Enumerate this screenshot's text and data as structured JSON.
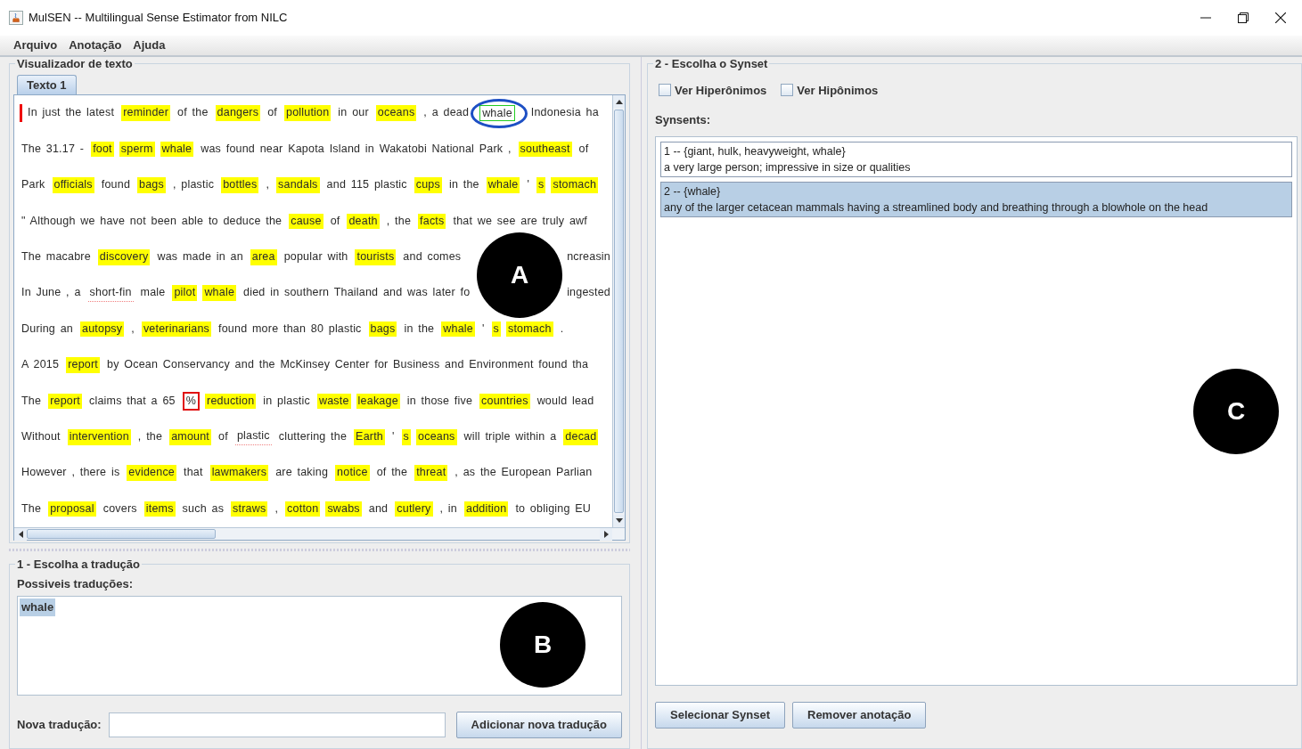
{
  "window": {
    "title": "MulSEN -- Multilingual Sense Estimator from NILC"
  },
  "menu": [
    "Arquivo",
    "Anotação",
    "Ajuda"
  ],
  "text_viewer": {
    "title": "Visualizador de texto",
    "cursor": true,
    "tabs": [
      {
        "label": "Texto 1",
        "selected": true
      }
    ],
    "callout": "A",
    "lines": [
      {
        "tokens": [
          {
            "text": "In just the latest",
            "kind": "plain"
          },
          {
            "text": "reminder",
            "kind": "highlight"
          },
          {
            "text": "of the",
            "kind": "plain"
          },
          {
            "text": "dangers",
            "kind": "highlight"
          },
          {
            "text": "of",
            "kind": "plain"
          },
          {
            "text": "pollution",
            "kind": "highlight"
          },
          {
            "text": "in our",
            "kind": "plain"
          },
          {
            "text": "oceans",
            "kind": "highlight"
          },
          {
            "text": ", a dead",
            "kind": "plain"
          },
          {
            "text": "whale",
            "kind": "selected",
            "circled": true
          },
          {
            "text": "Indonesia ha",
            "kind": "plain"
          }
        ]
      },
      {
        "tokens": [
          {
            "text": "The 31.17 -",
            "kind": "plain"
          },
          {
            "text": "foot",
            "kind": "highlight"
          },
          {
            "text": "sperm",
            "kind": "highlight"
          },
          {
            "text": "whale",
            "kind": "highlight"
          },
          {
            "text": "was found near Kapota Island in Wakatobi National Park ,",
            "kind": "plain"
          },
          {
            "text": "southeast",
            "kind": "highlight"
          },
          {
            "text": "of",
            "kind": "plain"
          }
        ]
      },
      {
        "tokens": [
          {
            "text": "Park",
            "kind": "plain"
          },
          {
            "text": "officials",
            "kind": "highlight"
          },
          {
            "text": "found",
            "kind": "plain"
          },
          {
            "text": "bags",
            "kind": "highlight"
          },
          {
            "text": ", plastic",
            "kind": "plain"
          },
          {
            "text": "bottles",
            "kind": "highlight"
          },
          {
            "text": ",",
            "kind": "plain"
          },
          {
            "text": "sandals",
            "kind": "highlight"
          },
          {
            "text": "and 115 plastic",
            "kind": "plain"
          },
          {
            "text": "cups",
            "kind": "highlight"
          },
          {
            "text": "in the",
            "kind": "plain"
          },
          {
            "text": "whale",
            "kind": "highlight"
          },
          {
            "text": "'",
            "kind": "plain"
          },
          {
            "text": "s",
            "kind": "highlight"
          },
          {
            "text": "stomach",
            "kind": "highlight"
          }
        ]
      },
      {
        "tokens": [
          {
            "text": "\" Although we have not been able to deduce the",
            "kind": "plain"
          },
          {
            "text": "cause",
            "kind": "highlight"
          },
          {
            "text": "of",
            "kind": "plain"
          },
          {
            "text": "death",
            "kind": "highlight"
          },
          {
            "text": ", the",
            "kind": "plain"
          },
          {
            "text": "facts",
            "kind": "highlight"
          },
          {
            "text": "that we see are truly awf",
            "kind": "plain"
          }
        ]
      },
      {
        "tokens": [
          {
            "text": "The macabre",
            "kind": "plain"
          },
          {
            "text": "discovery",
            "kind": "highlight"
          },
          {
            "text": "was made in an",
            "kind": "plain"
          },
          {
            "text": "area",
            "kind": "highlight"
          },
          {
            "text": "popular with",
            "kind": "plain"
          },
          {
            "text": "tourists",
            "kind": "highlight"
          },
          {
            "text": "and comes",
            "kind": "plain"
          },
          {
            "kind": "covered"
          },
          {
            "text": "ncreasin",
            "kind": "plain"
          }
        ]
      },
      {
        "tokens": [
          {
            "text": "In June , a",
            "kind": "plain"
          },
          {
            "text": "short-fin",
            "kind": "underlined"
          },
          {
            "text": "male",
            "kind": "plain"
          },
          {
            "text": "pilot",
            "kind": "highlight"
          },
          {
            "text": "whale",
            "kind": "highlight"
          },
          {
            "text": "died in southern Thailand and was later fo",
            "kind": "plain"
          },
          {
            "kind": "covered"
          },
          {
            "text": "ingested",
            "kind": "plain"
          }
        ]
      },
      {
        "tokens": [
          {
            "text": "During an",
            "kind": "plain"
          },
          {
            "text": "autopsy",
            "kind": "highlight"
          },
          {
            "text": ",",
            "kind": "plain"
          },
          {
            "text": "veterinarians",
            "kind": "highlight"
          },
          {
            "text": "found more than 80 plastic",
            "kind": "plain"
          },
          {
            "text": "bags",
            "kind": "highlight"
          },
          {
            "text": "in the",
            "kind": "plain"
          },
          {
            "text": "whale",
            "kind": "highlight"
          },
          {
            "text": "'",
            "kind": "plain"
          },
          {
            "text": "s",
            "kind": "highlight"
          },
          {
            "text": "stomach",
            "kind": "highlight"
          },
          {
            "text": ".",
            "kind": "plain"
          }
        ]
      },
      {
        "tokens": [
          {
            "text": "A 2015",
            "kind": "plain"
          },
          {
            "text": "report",
            "kind": "highlight"
          },
          {
            "text": "by Ocean Conservancy and the McKinsey Center for Business and Environment found tha",
            "kind": "plain"
          }
        ]
      },
      {
        "tokens": [
          {
            "text": "The",
            "kind": "plain"
          },
          {
            "text": "report",
            "kind": "highlight"
          },
          {
            "text": "claims that a 65",
            "kind": "plain"
          },
          {
            "text": "%",
            "kind": "flagged"
          },
          {
            "text": "reduction",
            "kind": "highlight"
          },
          {
            "text": "in plastic",
            "kind": "plain"
          },
          {
            "text": "waste",
            "kind": "highlight"
          },
          {
            "text": "leakage",
            "kind": "highlight"
          },
          {
            "text": "in those five",
            "kind": "plain"
          },
          {
            "text": "countries",
            "kind": "highlight"
          },
          {
            "text": "would lead",
            "kind": "plain"
          }
        ]
      },
      {
        "tokens": [
          {
            "text": "Without",
            "kind": "plain"
          },
          {
            "text": "intervention",
            "kind": "highlight"
          },
          {
            "text": ", the",
            "kind": "plain"
          },
          {
            "text": "amount",
            "kind": "highlight"
          },
          {
            "text": "of",
            "kind": "plain"
          },
          {
            "text": "plastic",
            "kind": "underlined"
          },
          {
            "text": "cluttering the",
            "kind": "plain"
          },
          {
            "text": "Earth",
            "kind": "highlight"
          },
          {
            "text": "'",
            "kind": "plain"
          },
          {
            "text": "s",
            "kind": "highlight"
          },
          {
            "text": "oceans",
            "kind": "highlight"
          },
          {
            "text": "will triple within a",
            "kind": "plain"
          },
          {
            "text": "decad",
            "kind": "highlight"
          }
        ]
      },
      {
        "tokens": [
          {
            "text": "However , there is",
            "kind": "plain"
          },
          {
            "text": "evidence",
            "kind": "highlight"
          },
          {
            "text": "that",
            "kind": "plain"
          },
          {
            "text": "lawmakers",
            "kind": "highlight"
          },
          {
            "text": "are taking",
            "kind": "plain"
          },
          {
            "text": "notice",
            "kind": "highlight"
          },
          {
            "text": "of the",
            "kind": "plain"
          },
          {
            "text": "threat",
            "kind": "highlight"
          },
          {
            "text": ", as the European Parlian",
            "kind": "plain"
          }
        ]
      },
      {
        "tokens": [
          {
            "text": "The",
            "kind": "plain"
          },
          {
            "text": "proposal",
            "kind": "highlight"
          },
          {
            "text": "covers",
            "kind": "plain"
          },
          {
            "text": "items",
            "kind": "highlight"
          },
          {
            "text": "such as",
            "kind": "plain"
          },
          {
            "text": "straws",
            "kind": "highlight"
          },
          {
            "text": ",",
            "kind": "plain"
          },
          {
            "text": "cotton",
            "kind": "highlight"
          },
          {
            "text": "swabs",
            "kind": "highlight"
          },
          {
            "text": "and",
            "kind": "plain"
          },
          {
            "text": "cutlery",
            "kind": "highlight"
          },
          {
            "text": ", in",
            "kind": "plain"
          },
          {
            "text": "addition",
            "kind": "highlight"
          },
          {
            "text": "to obliging EU",
            "kind": "plain"
          }
        ]
      }
    ]
  },
  "translation": {
    "title": "1 - Escolha a tradução",
    "list_label": "Possiveis traduções:",
    "items": [
      {
        "text": "whale",
        "selected": true
      }
    ],
    "callout": "B",
    "new_label": "Nova tradução:",
    "add_button": "Adicionar nova tradução"
  },
  "synset": {
    "title": "2 - Escolha o Synset",
    "checkboxes": [
      {
        "label": "Ver Hiperônimos",
        "checked": false
      },
      {
        "label": "Ver Hipônimos",
        "checked": false
      }
    ],
    "list_label": "Synsents:",
    "items": [
      {
        "header": "1 -- {giant, hulk, heavyweight, whale}",
        "gloss": "a very large person; impressive in size or qualities",
        "selected": false
      },
      {
        "header": "2 -- {whale}",
        "gloss": "any of the larger cetacean mammals having a streamlined body and breathing through a blowhole on the head",
        "selected": true
      }
    ],
    "callout": "C",
    "buttons": [
      "Selecionar Synset",
      "Remover anotação"
    ]
  }
}
